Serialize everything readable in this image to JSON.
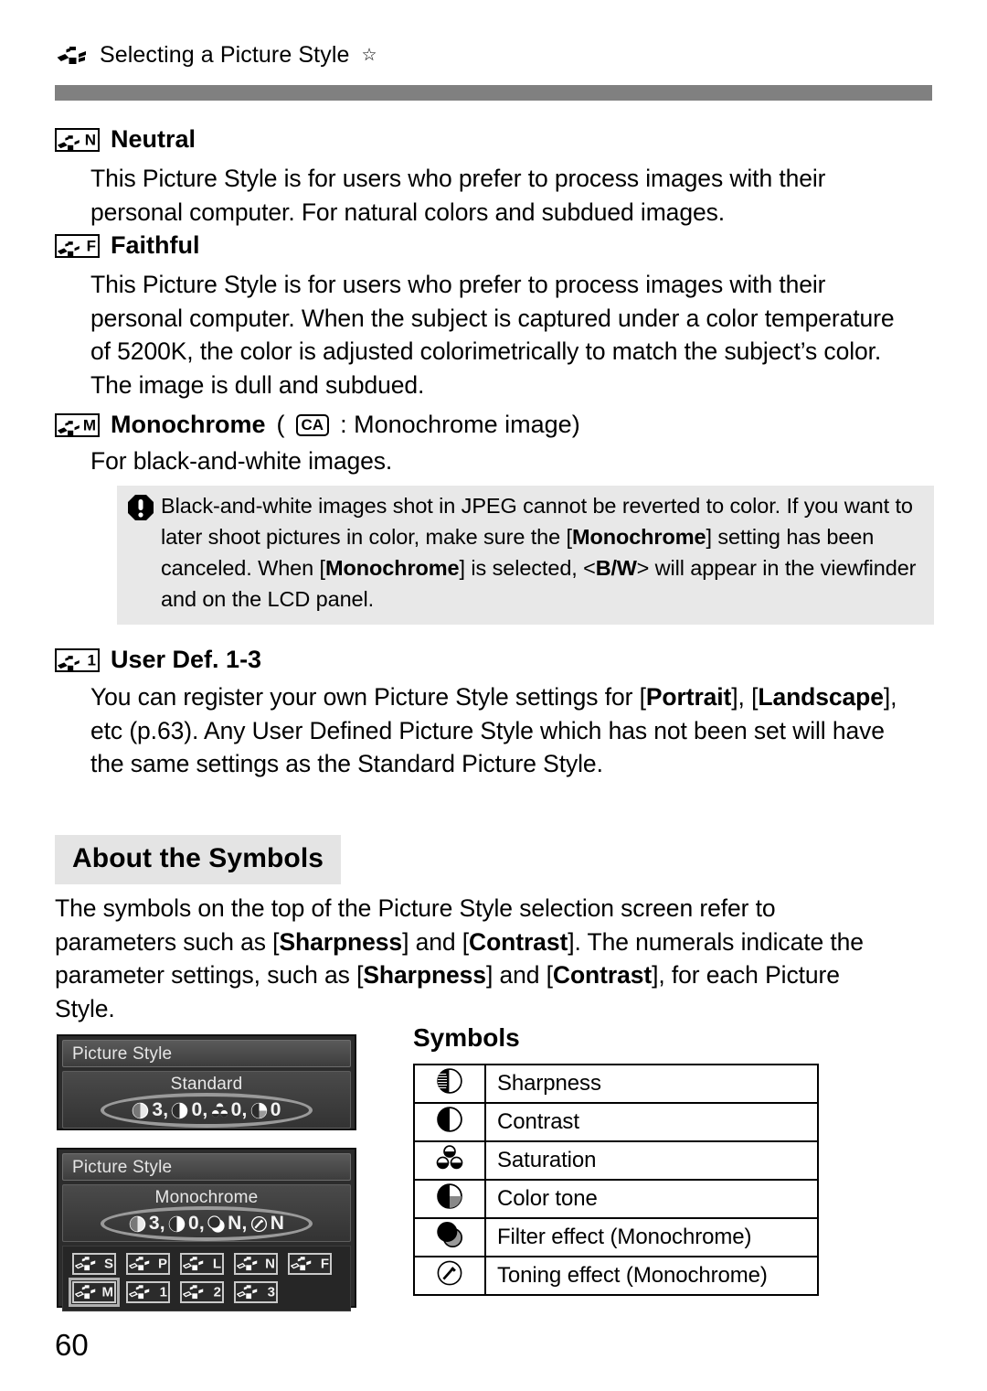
{
  "running_head": {
    "icon": "picture-style-icon",
    "title": "Selecting a Picture Style",
    "star": "☆"
  },
  "sections": [
    {
      "id": "neutral",
      "badge_letter": "N",
      "heading": "Neutral",
      "body": "This Picture Style is for users who prefer to process images with their personal computer. For natural colors and subdued images."
    },
    {
      "id": "faithful",
      "badge_letter": "F",
      "heading": "Faithful",
      "body": "This Picture Style is for users who prefer to process images with their personal computer. When the subject is captured under a color temperature of 5200K, the color is adjusted colorimetrically to match the subject’s color. The image is dull and subdued."
    },
    {
      "id": "monochrome",
      "badge_letter": "M",
      "heading": "Monochrome",
      "heading_suffix_open": "(",
      "heading_ca_icon": "CA",
      "heading_suffix_rest": ": Monochrome image)",
      "body": "For black-and-white images."
    },
    {
      "id": "user-def",
      "badge_letter": "1",
      "heading": "User Def. 1-3",
      "body_parts": [
        {
          "t": "You can register your own Picture Style settings for [",
          "b": false
        },
        {
          "t": "Portrait",
          "b": true
        },
        {
          "t": "], [",
          "b": false
        },
        {
          "t": "Landscape",
          "b": true
        },
        {
          "t": "], etc (p.63). Any User Defined Picture Style which has not been set will have the same settings as the Standard Picture Style.",
          "b": false
        }
      ]
    }
  ],
  "note": {
    "icon": "warning-octagon-icon",
    "parts": [
      {
        "t": "Black-and-white images shot in JPEG cannot be reverted to color. If you want to later shoot pictures in color, make sure the [",
        "b": false
      },
      {
        "t": "Monochrome",
        "b": true
      },
      {
        "t": "] setting has been canceled. When [",
        "b": false
      },
      {
        "t": "Monochrome",
        "b": true
      },
      {
        "t": "] is selected, <",
        "b": false
      },
      {
        "t": "B/W",
        "b": true,
        "bw": true
      },
      {
        "t": "> will appear in the viewfinder and on the LCD panel.",
        "b": false
      }
    ]
  },
  "about": {
    "heading": "About the Symbols",
    "body_parts": [
      {
        "t": "The symbols on the top of the Picture Style selection screen refer to parameters such as [",
        "b": false
      },
      {
        "t": "Sharpness",
        "b": true
      },
      {
        "t": "] and [",
        "b": false
      },
      {
        "t": "Contrast",
        "b": true
      },
      {
        "t": "]. The numerals indicate the parameter settings, such as [",
        "b": false
      },
      {
        "t": "Sharpness",
        "b": true
      },
      {
        "t": "] and [",
        "b": false
      },
      {
        "t": "Contrast",
        "b": true
      },
      {
        "t": "], for each Picture Style.",
        "b": false
      }
    ]
  },
  "lcd_screens": [
    {
      "id": "lcd-standard",
      "titlebar": "Picture Style",
      "style_name": "Standard",
      "values": [
        {
          "icon": "sharpness-icon",
          "text": "3,"
        },
        {
          "icon": "contrast-icon",
          "text": "0,"
        },
        {
          "icon": "saturation-icon",
          "text": "0,"
        },
        {
          "icon": "color-tone-icon",
          "text": "0"
        }
      ],
      "has_grid": false
    },
    {
      "id": "lcd-monochrome",
      "titlebar": "Picture Style",
      "style_name": "Monochrome",
      "values": [
        {
          "icon": "sharpness-icon",
          "text": "3,"
        },
        {
          "icon": "contrast-icon",
          "text": "0,"
        },
        {
          "icon": "filter-effect-icon",
          "text": "N,"
        },
        {
          "icon": "toning-effect-icon",
          "text": "N"
        }
      ],
      "has_grid": true,
      "grid": [
        [
          {
            "letter": "S",
            "selected": false
          },
          {
            "letter": "P",
            "selected": false
          },
          {
            "letter": "L",
            "selected": false
          },
          {
            "letter": "N",
            "selected": false
          },
          {
            "letter": "F",
            "selected": false
          }
        ],
        [
          {
            "letter": "M",
            "selected": true
          },
          {
            "letter": "1",
            "selected": false
          },
          {
            "letter": "2",
            "selected": false
          },
          {
            "letter": "3",
            "selected": false
          }
        ]
      ]
    }
  ],
  "symbols": {
    "title": "Symbols",
    "rows": [
      {
        "icon": "sharpness-icon",
        "label": "Sharpness"
      },
      {
        "icon": "contrast-icon",
        "label": "Contrast"
      },
      {
        "icon": "saturation-icon",
        "label": "Saturation"
      },
      {
        "icon": "color-tone-icon",
        "label": "Color tone"
      },
      {
        "icon": "filter-effect-icon",
        "label": "Filter effect (Monochrome)"
      },
      {
        "icon": "toning-effect-icon",
        "label": "Toning effect (Monochrome)"
      }
    ]
  },
  "page_number": "60",
  "colors": {
    "rule_gray": "#808080",
    "note_gray": "#e8e8e8",
    "heading_gray": "#e4e4e4",
    "lcd_dark": "#2c2c2c"
  }
}
